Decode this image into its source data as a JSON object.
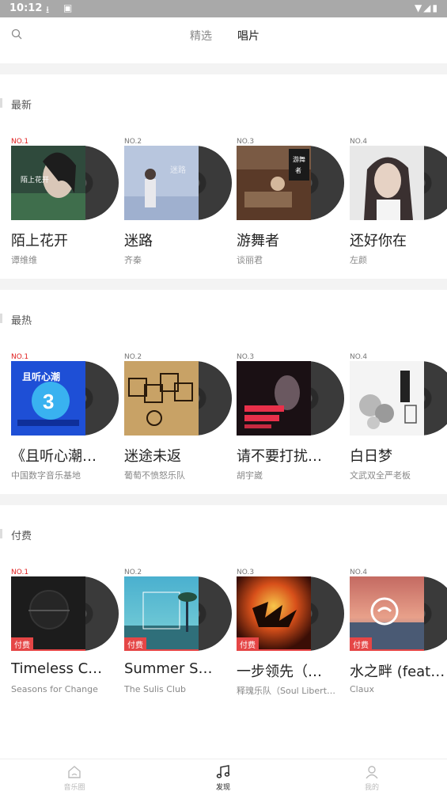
{
  "status_bar": {
    "time": "10:12"
  },
  "top_tabs": [
    {
      "label": "精选"
    },
    {
      "label": "唱片"
    }
  ],
  "sections": [
    {
      "title": "最新",
      "items": [
        {
          "rank": "NO.1",
          "name": "陌上花开",
          "artist": "谭维维",
          "paid": false
        },
        {
          "rank": "NO.2",
          "name": "迷路",
          "artist": "齐秦",
          "paid": false
        },
        {
          "rank": "NO.3",
          "name": "游舞者",
          "artist": "谈丽君",
          "paid": false
        },
        {
          "rank": "NO.4",
          "name": "还好你在",
          "artist": "左颜",
          "paid": false
        }
      ]
    },
    {
      "title": "最热",
      "items": [
        {
          "rank": "NO.1",
          "name": "《且听心潮》…",
          "artist": "中国数字音乐基地",
          "paid": false
        },
        {
          "rank": "NO.2",
          "name": "迷途未返",
          "artist": "葡萄不愤怒乐队",
          "paid": false
        },
        {
          "rank": "NO.3",
          "name": "请不要打扰我…",
          "artist": "胡宇崴",
          "paid": false
        },
        {
          "rank": "NO.4",
          "name": "白日梦",
          "artist": "文武双全严老板",
          "paid": false
        }
      ]
    },
    {
      "title": "付费",
      "items": [
        {
          "rank": "NO.1",
          "name": "Timeless Coll…",
          "artist": "Seasons for Change",
          "paid": true
        },
        {
          "rank": "NO.2",
          "name": "Summer Sonic",
          "artist": "The Sulis Club",
          "paid": true
        },
        {
          "rank": "NO.3",
          "name": "一步领先（O…",
          "artist": "释瑰乐队（Soul Liberty）",
          "paid": true
        },
        {
          "rank": "NO.4",
          "name": "水之畔 (feat. …",
          "artist": "Claux",
          "paid": true
        }
      ]
    }
  ],
  "paid_badge": "付费",
  "bottom_nav": [
    {
      "label": "音乐圈"
    },
    {
      "label": "发现"
    },
    {
      "label": "我的"
    }
  ],
  "colors": {
    "accent_red": "#e02020",
    "badge_red": "#e54646"
  }
}
